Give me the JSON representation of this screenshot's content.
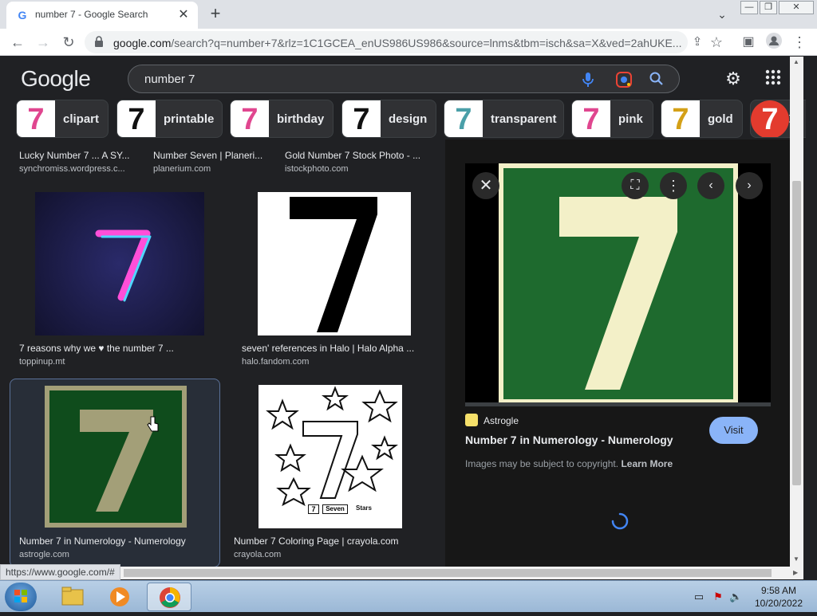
{
  "browser": {
    "tab_title": "number 7 - Google Search",
    "new_tab": "+",
    "url_domain": "google.com",
    "url_rest": "/search?q=number+7&rlz=1C1GCEA_enUS986US986&source=lnms&tbm=isch&sa=X&ved=2ahUKE...",
    "status_url": "https://www.google.com/#"
  },
  "google": {
    "logo": "Google",
    "query": "number 7"
  },
  "chips": [
    {
      "label": "clipart",
      "glyph": "7",
      "color": "#e0468f"
    },
    {
      "label": "printable",
      "glyph": "7",
      "color": "#111111"
    },
    {
      "label": "birthday",
      "glyph": "7",
      "color": "#e0468f"
    },
    {
      "label": "design",
      "glyph": "7",
      "color": "#111111"
    },
    {
      "label": "transparent",
      "glyph": "7",
      "color": "#4a9fa8"
    },
    {
      "label": "pink",
      "glyph": "7",
      "color": "#e0468f"
    },
    {
      "label": "gold",
      "glyph": "7",
      "color": "#d4a017"
    },
    {
      "label": "",
      "glyph": "7",
      "color": "#e33b2e"
    }
  ],
  "results": {
    "row1": [
      {
        "caption": "Lucky Number 7 ... A SY...",
        "source": "synchromiss.wordpress.c..."
      },
      {
        "caption": "Number Seven | Planeri...",
        "source": "planerium.com"
      },
      {
        "caption": "Gold Number 7 Stock Photo - ...",
        "source": "istockphoto.com"
      }
    ],
    "row2": [
      {
        "caption": "7 reasons why we ♥ the number 7 ...",
        "source": "toppinup.mt",
        "glyph": "7"
      },
      {
        "caption": "seven' references in Halo | Halo Alpha ...",
        "source": "halo.fandom.com",
        "glyph": "7"
      }
    ],
    "row3": [
      {
        "caption": "Number 7 in Numerology - Numerology",
        "source": "astrogle.com",
        "glyph": "7"
      },
      {
        "caption": "Number 7 Coloring Page | crayola.com",
        "source": "crayola.com",
        "glyph": "7",
        "box_label": "7",
        "box_word": "Seven",
        "box_word2": "Stars"
      }
    ]
  },
  "preview": {
    "glyph": "7",
    "site": "Astrogle",
    "title": "Number 7 in Numerology - Numerology",
    "visit_label": "Visit",
    "copyright": "Images may be subject to copyright.",
    "learn_more": "Learn More"
  },
  "taskbar": {
    "time": "9:58 AM",
    "date": "10/20/2022"
  },
  "colors": {
    "accent_blue": "#8ab4f8",
    "bg_dark": "#202124",
    "preview_green": "#1e6a2e",
    "preview_cream": "#f3f0c8"
  }
}
